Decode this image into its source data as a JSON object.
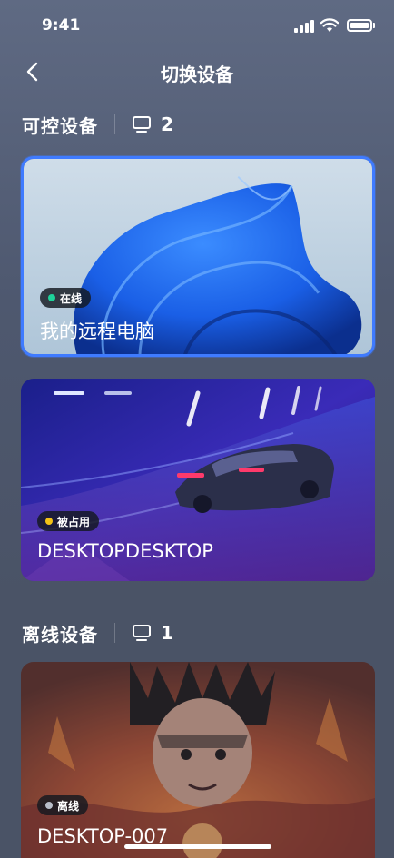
{
  "status_bar": {
    "time": "9:41"
  },
  "nav": {
    "title": "切换设备"
  },
  "controllable": {
    "label": "可控设备",
    "count": "2"
  },
  "offline": {
    "label": "离线设备",
    "count": "1"
  },
  "devices": [
    {
      "name": "我的远程电脑",
      "status": "在线",
      "status_color": "#1ed39a"
    },
    {
      "name": "DESKTOPDESKTOP",
      "status": "被占用",
      "status_color": "#f3c317"
    },
    {
      "name": "DESKTOP-007",
      "status": "离线",
      "status_color": "#b9bec9"
    }
  ],
  "colors": {
    "accent": "#3f7bff",
    "background": "#4e586f"
  }
}
